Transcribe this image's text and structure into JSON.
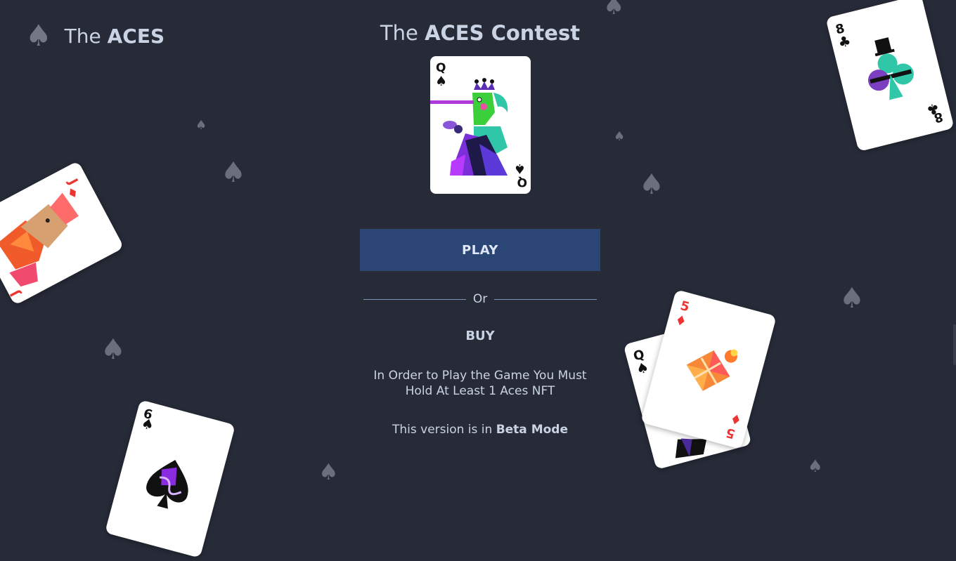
{
  "brand": {
    "prefix": "The ",
    "name": "ACES",
    "icon": "spade-icon"
  },
  "contest": {
    "prefix": "The ",
    "name": "ACES Contest"
  },
  "actions": {
    "play_label": "PLAY",
    "or_label": "Or",
    "buy_label": "BUY"
  },
  "info": {
    "line1": "In Order to Play the Game You Must",
    "line2": "Hold At Least 1 Aces NFT"
  },
  "beta": {
    "prefix": "This version is in ",
    "mode": "Beta Mode"
  },
  "cards": {
    "queen_spades": {
      "rank": "Q",
      "suit": "♠"
    },
    "jack_diamonds": {
      "rank": "J",
      "suit": "♦"
    },
    "eight_clubs": {
      "rank": "8",
      "suit": "♣"
    },
    "five_diamonds": {
      "rank": "5",
      "suit": "♦"
    },
    "queen_spades_back": {
      "rank": "Q",
      "suit": "♠"
    },
    "nine_spades": {
      "rank": "9",
      "suit": "♠"
    }
  },
  "colors": {
    "background": "#272b38",
    "play_button": "#2b4675",
    "text": "#c9d3e3"
  }
}
